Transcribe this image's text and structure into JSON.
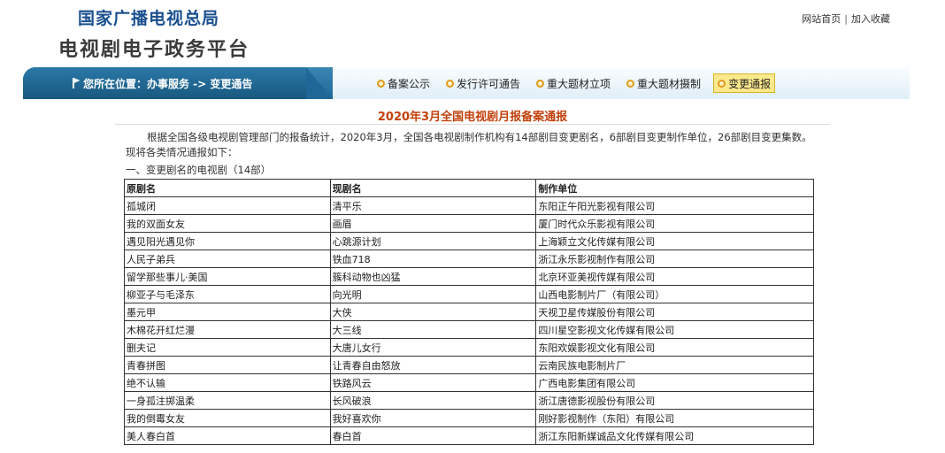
{
  "header": {
    "site_name": "国家广播电视总局",
    "platform_name": "电视剧电子政务平台",
    "links": [
      "网站首页",
      "加入收藏"
    ],
    "separator": "|"
  },
  "navbar": {
    "location": "您所在位置：办事服务 -> 变更通告",
    "tabs": [
      {
        "label": "备案公示",
        "active": false
      },
      {
        "label": "发行许可通告",
        "active": false
      },
      {
        "label": "重大题材立项",
        "active": false
      },
      {
        "label": "重大题材摄制",
        "active": false
      },
      {
        "label": "变更通报",
        "active": true
      }
    ]
  },
  "main": {
    "title": "2020年3月全国电视剧月报备案通报",
    "intro": "根据全国各级电视剧管理部门的报备统计，2020年3月，全国各电视剧制作机构有14部剧目变更剧名，6部剧目变更制作单位，26部剧目变更集数。现将各类情况通报如下：",
    "section_title": "一、变更剧名的电视剧（14部）",
    "table": {
      "headers": [
        "原剧名",
        "现剧名",
        "制作单位"
      ],
      "rows": [
        [
          "孤城闭",
          "清平乐",
          "东阳正午阳光影视有限公司"
        ],
        [
          "我的双面女友",
          "画眉",
          "厦门时代众乐影视有限公司"
        ],
        [
          "遇见阳光遇见你",
          "心跳源计划",
          "上海颖立文化传媒有限公司"
        ],
        [
          "人民子弟兵",
          "铁血718",
          "浙江永乐影视制作有限公司"
        ],
        [
          "留学那些事儿·美国",
          "簇科动物也凶猛",
          "北京环亚美视传媒有限公司"
        ],
        [
          "柳亚子与毛泽东",
          "向光明",
          "山西电影制片厂（有限公司）"
        ],
        [
          "墨元甲",
          "大侠",
          "天视卫星传媒股份有限公司"
        ],
        [
          "木棉花开红烂漫",
          "大三线",
          "四川星空影视文化传媒有限公司"
        ],
        [
          "删夫记",
          "大唐儿女行",
          "东阳欢娱影视文化有限公司"
        ],
        [
          "青春拼图",
          "让青春自由怒放",
          "云南民族电影制片厂"
        ],
        [
          "绝不认输",
          "铁路风云",
          "广西电影集团有限公司"
        ],
        [
          "一身孤注掷温柔",
          "长风破浪",
          "浙江唐德影视股份有限公司"
        ],
        [
          "我的倒霉女友",
          "我好喜欢你",
          "刚好影视制作（东阳）有限公司"
        ],
        [
          "美人春白首",
          "春白首",
          "浙江东阳新媒诚品文化传媒有限公司"
        ]
      ]
    }
  }
}
